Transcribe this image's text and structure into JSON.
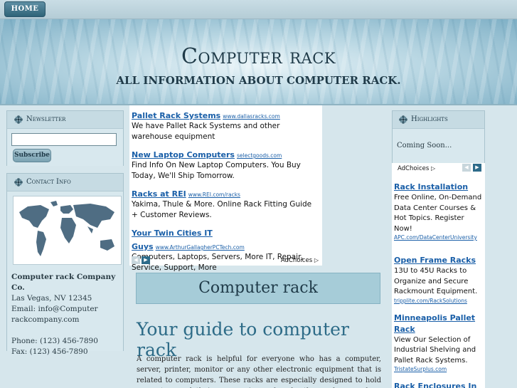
{
  "nav": {
    "home_label": "HOME"
  },
  "header": {
    "title": "Computer rack",
    "subtitle": "ALL INFORMATION ABOUT COMPUTER RACK."
  },
  "newsletter": {
    "title": "Newsletter",
    "input_value": "",
    "subscribe_label": "Subscribe"
  },
  "contact": {
    "title": "Contact Info",
    "company": "Computer rack Company Co.",
    "city": "Las Vegas, NV 12345",
    "email_line1": "Email: info@Computer",
    "email_line2": "rackcompany.com",
    "phone": "Phone: (123) 456-7890",
    "fax": "Fax: (123) 456-7890"
  },
  "center_ads": {
    "items": [
      {
        "title": "Pallet Rack Systems",
        "url": "www.dallasracks.com",
        "desc": "We have Pallet Rack Systems and other warehouse equipment"
      },
      {
        "title": "New Laptop Computers",
        "url": "selectgoods.com",
        "desc": "Find Info On New Laptop Computers. You Buy Today, We'll Ship Tomorrow."
      },
      {
        "title": "Racks at REI",
        "url": "www.REI.com/racks",
        "desc": "Yakima, Thule & More. Online Rack Fitting Guide + Customer Reviews."
      },
      {
        "title": "Your Twin Cities IT Guys",
        "url": "www.ArthurGallagherPCTech.com",
        "desc": "Computers, Laptops, Servers, More IT, Repair, Service, Support, More"
      }
    ],
    "adchoices": "AdChoices"
  },
  "main": {
    "box_title": "Computer rack",
    "guide_title": "Your guide to computer rack",
    "paragraph": "A computer rack is helpful for everyone who has a computer, server, printer, monitor or any other electronic equipment that is related to computers. These racks are especially designed to hold computers and their accessories and make the workspace clean and organized."
  },
  "highlights": {
    "title": "Highlights",
    "body": "Coming Soon..."
  },
  "right_ads": {
    "adchoices": "AdChoices",
    "items": [
      {
        "title": "Rack Installation",
        "desc": "Free Online, On-Demand Data Center Courses & Hot Topics. Register Now!",
        "url": "APC.com/DataCenterUniversity"
      },
      {
        "title": "Open Frame Racks",
        "desc": "13U to 45U Racks to Organize and Secure Rackmount Equipment.",
        "url": "tripplite.com/RackSolutions"
      },
      {
        "title": "Minneapolis Pallet Rack",
        "desc": "View Our Selection of Industrial Shelving and Pallet Rack Systems.",
        "url": "TristateSurplus.com"
      },
      {
        "title": "Rack Enclosures In",
        "desc": "",
        "url": ""
      }
    ]
  },
  "colors": {
    "accent": "#2d6b87",
    "link": "#1a5fa8",
    "panel": "#c6dbe3"
  },
  "icons": {
    "panel_title": "flower-icon",
    "ad_prev": "chevron-left-icon",
    "ad_next": "chevron-right-icon",
    "adchoices": "adchoices-icon",
    "map": "world-map"
  }
}
